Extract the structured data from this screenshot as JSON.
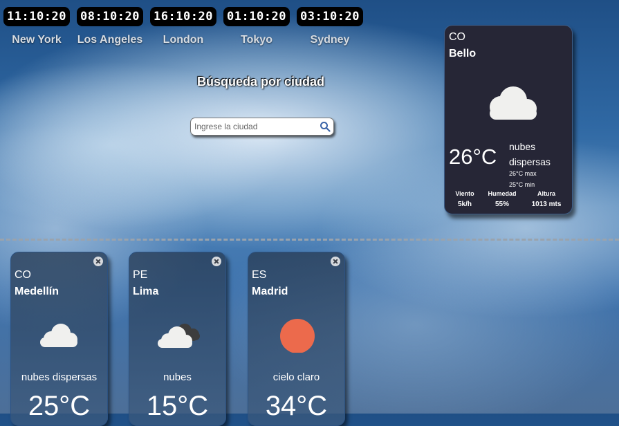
{
  "clocks": [
    {
      "time": "11:10:20",
      "city": "New York"
    },
    {
      "time": "08:10:20",
      "city": "Los Angeles"
    },
    {
      "time": "16:10:20",
      "city": "London"
    },
    {
      "time": "01:10:20",
      "city": "Tokyo"
    },
    {
      "time": "03:10:20",
      "city": "Sydney"
    }
  ],
  "search": {
    "title": "Búsqueda por ciudad",
    "placeholder": "Ingrese la ciudad",
    "icon": "search-icon"
  },
  "main_card": {
    "country": "CO",
    "city": "Bello",
    "icon": "cloud-icon",
    "temp": "26°C",
    "desc": "nubes dispersas",
    "max": "26°C max",
    "min": "25°C min",
    "stats": {
      "wind_label": "Viento",
      "wind": "5k/h",
      "humidity_label": "Humedad",
      "humidity": "55%",
      "altitude_label": "Altura",
      "altitude": "1013 mts"
    }
  },
  "cards": [
    {
      "country": "CO",
      "city": "Medellín",
      "icon": "cloud-icon",
      "desc": "nubes dispersas",
      "temp": "25°C"
    },
    {
      "country": "PE",
      "city": "Lima",
      "icon": "broken-clouds-icon",
      "desc": "nubes",
      "temp": "15°C"
    },
    {
      "country": "ES",
      "city": "Madrid",
      "icon": "sun-icon",
      "desc": "cielo claro",
      "temp": "34°C"
    }
  ],
  "colors": {
    "card_bg": "#262636",
    "sun": "#ec6a4c",
    "cloud": "#f0f0ee"
  }
}
